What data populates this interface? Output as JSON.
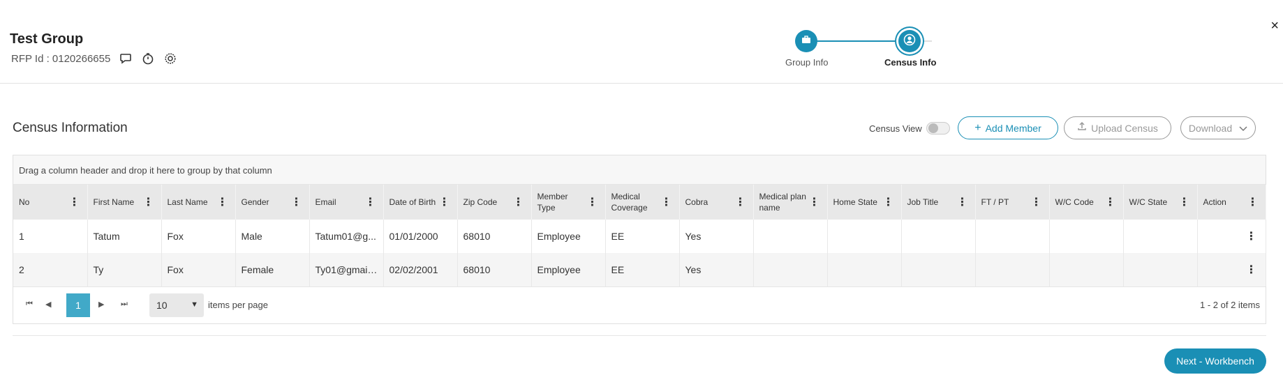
{
  "header": {
    "group_title": "Test Group",
    "rfp_label": "RFP Id : 0120266655",
    "icons": [
      "comment-icon",
      "timer-icon",
      "settings-icon"
    ],
    "close_glyph": "×"
  },
  "stepper": {
    "steps": [
      {
        "label": "Group Info",
        "icon": "briefcase-icon",
        "active": false
      },
      {
        "label": "Census Info",
        "icon": "user-circle-icon",
        "active": true
      }
    ],
    "accent": "#1a8fb5"
  },
  "section": {
    "title": "Census Information",
    "census_view_label": "Census View",
    "census_view_on": false,
    "add_member": "Add Member",
    "upload_census": "Upload Census",
    "download": "Download"
  },
  "grid": {
    "group_panel_hint": "Drag a column header and drop it here to group by that column",
    "columns": [
      "No",
      "First Name",
      "Last Name",
      "Gender",
      "Email",
      "Date of Birth",
      "Zip Code",
      "Member Type",
      "Medical Coverage",
      "Cobra",
      "Medical plan name",
      "Home State",
      "Job Title",
      "FT / PT",
      "W/C Code",
      "W/C State",
      "Action"
    ],
    "rows": [
      [
        "1",
        "Tatum",
        "Fox",
        "Male",
        "Tatum01@g...",
        "01/01/2000",
        "68010",
        "Employee",
        "EE",
        "Yes",
        "",
        "",
        "",
        "",
        "",
        "",
        ""
      ],
      [
        "2",
        "Ty",
        "Fox",
        "Female",
        "Ty01@gmail....",
        "02/02/2001",
        "68010",
        "Employee",
        "EE",
        "Yes",
        "",
        "",
        "",
        "",
        "",
        "",
        ""
      ]
    ],
    "pager": {
      "current_page": "1",
      "page_size": "10",
      "items_per_page_label": "items per page",
      "summary": "1 - 2 of 2 items"
    }
  },
  "footer": {
    "next_button": "Next - Workbench"
  },
  "colors": {
    "accent": "#1a8fb5",
    "pager_active": "#41a9c8"
  }
}
